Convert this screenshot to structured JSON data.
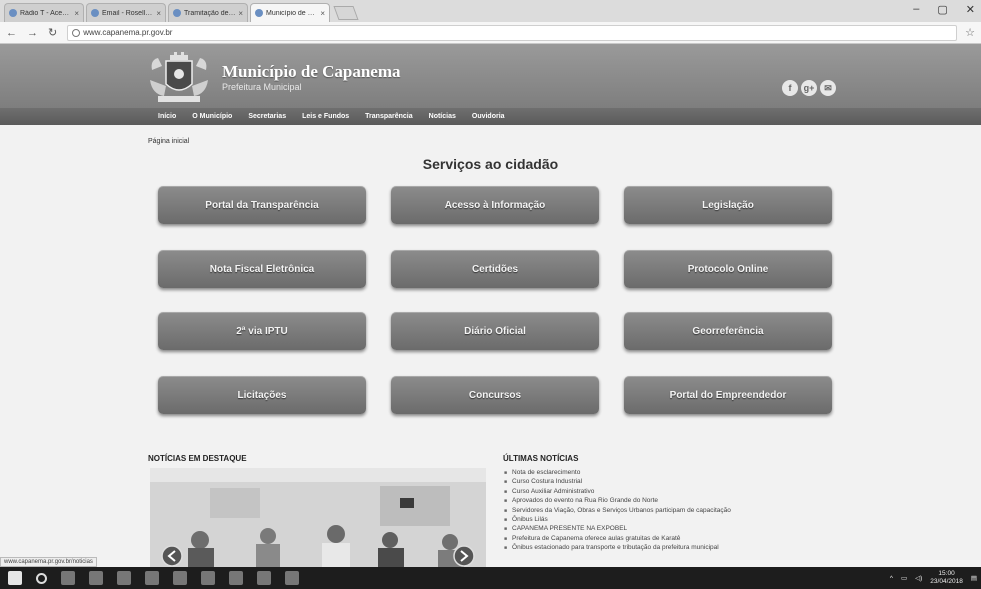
{
  "browser": {
    "tabs": [
      {
        "label": "Rádio T - Acesso ...",
        "active": false
      },
      {
        "label": "Email - Rosella ...",
        "active": false
      },
      {
        "label": "Tramitação de processo",
        "active": false
      },
      {
        "label": "Município de Capanema",
        "active": true
      }
    ],
    "url": "www.capanema.pr.gov.br"
  },
  "site": {
    "title": "Município de Capanema",
    "subtitle": "Prefeitura Municipal",
    "nav": [
      "Início",
      "O Município",
      "Secretarias",
      "Leis e Fundos",
      "Transparência",
      "Notícias",
      "Ouvidoria"
    ],
    "social": [
      "f",
      "g+",
      "✉"
    ]
  },
  "breadcrumb": "Página inicial",
  "services_title": "Serviços ao cidadão",
  "services": [
    "Portal da Transparência",
    "Acesso à Informação",
    "Legislação",
    "Nota Fiscal Eletrônica",
    "Certidões",
    "Protocolo Online",
    "2ª via IPTU",
    "Diário Oficial",
    "Georreferência",
    "Licitações",
    "Concursos",
    "Portal do Empreendedor"
  ],
  "news": {
    "featured_heading": "NOTÍCIAS EM DESTAQUE",
    "latest_heading": "ÚLTIMAS NOTÍCIAS",
    "latest": [
      "Nota de esclarecimento",
      "Curso Costura Industrial",
      "Curso Auxiliar Administrativo",
      "Aprovados do evento na Rua Rio Grande do Norte",
      "Servidores da Viação, Obras e Serviços Urbanos participam de capacitação",
      "Ônibus Lilás",
      "CAPANEMA PRESENTE NA EXPOBEL",
      "Prefeitura de Capanema oferece aulas gratuitas de Karatê",
      "Ônibus estacionado para transporte e tributação da prefeitura municipal"
    ]
  },
  "status_url": "www.capanema.pr.gov.br/noticias",
  "taskbar": {
    "time": "15:00",
    "date": "23/04/2018"
  }
}
